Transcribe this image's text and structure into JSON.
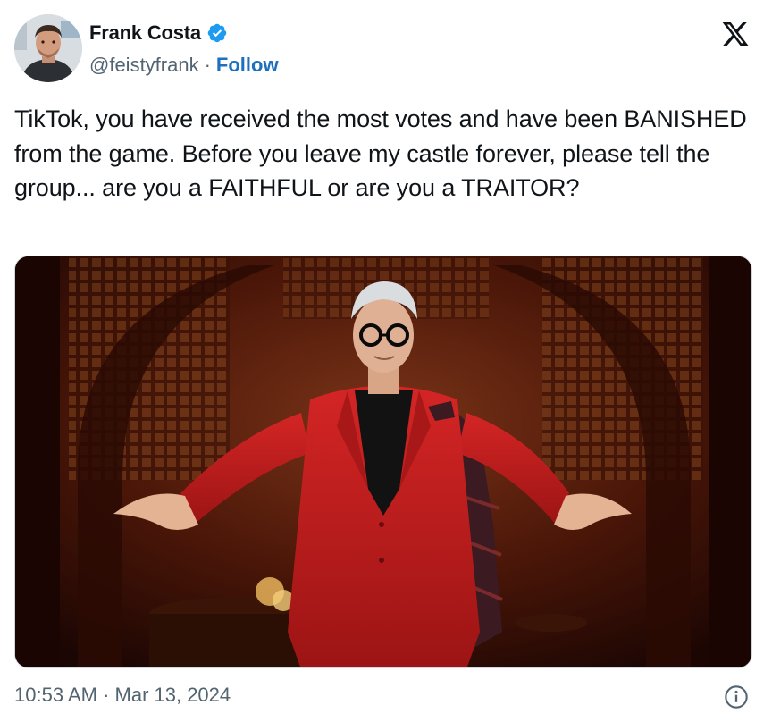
{
  "author": {
    "display_name": "Frank Costa",
    "handle": "@feistyfrank",
    "separator": "·",
    "follow_label": "Follow",
    "verified": true
  },
  "tweet": {
    "text": "TikTok, you have received the most votes and have been BANISHED from the game. Before you leave my castle forever, please tell the group... are you a FAITHFUL or are you a TRAITOR?",
    "timestamp": "10:53 AM · Mar 13, 2024"
  },
  "icons": {
    "platform_logo": "x-logo-icon",
    "verified_badge": "verified-badge-icon",
    "info": "info-icon"
  },
  "colors": {
    "text": "#0f1419",
    "secondary_text": "#536471",
    "link": "#1d70bd",
    "verified_blue": "#1d9bf0",
    "media_suit_red": "#c81f1f"
  }
}
